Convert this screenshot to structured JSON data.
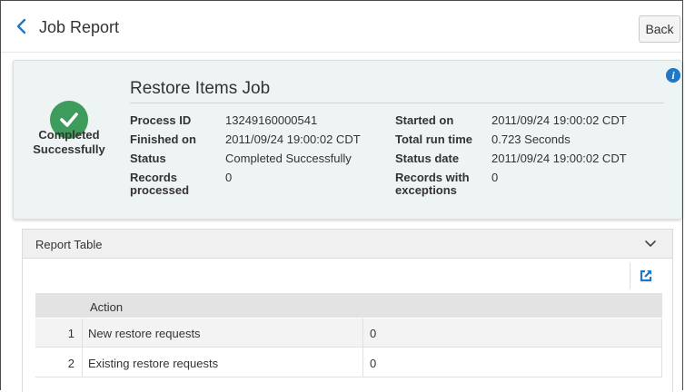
{
  "header": {
    "title": "Job Report",
    "back_label": "Back"
  },
  "summary": {
    "status": "Completed Successfully",
    "job_name": "Restore Items Job",
    "left_fields": [
      {
        "label": "Process ID",
        "value": "13249160000541"
      },
      {
        "label": "Finished on",
        "value": "2011/09/24 19:00:02 CDT"
      },
      {
        "label": "Status",
        "value": "Completed Successfully"
      },
      {
        "label": "Records processed",
        "value": "0"
      }
    ],
    "right_fields": [
      {
        "label": "Started on",
        "value": "2011/09/24 19:00:02 CDT"
      },
      {
        "label": "Total run time",
        "value": "0.723 Seconds"
      },
      {
        "label": "Status date",
        "value": "2011/09/24 19:00:02 CDT"
      },
      {
        "label": "Records with exceptions",
        "value": "0"
      }
    ],
    "info_glyph": "i"
  },
  "report_table": {
    "title": "Report Table",
    "columns": [
      "Action"
    ],
    "rows": [
      {
        "index": "1",
        "action": "New restore requests",
        "value": "0"
      },
      {
        "index": "2",
        "action": "Existing restore requests",
        "value": "0"
      }
    ]
  },
  "icons": {
    "back": "chevron-left-icon",
    "status": "check-circle-icon",
    "info": "info-icon",
    "collapse": "chevron-down-icon",
    "export": "export-icon"
  },
  "colors": {
    "accent": "#1f77c8",
    "success": "#3d9b5c",
    "summary_bg": "#eef3f4"
  }
}
